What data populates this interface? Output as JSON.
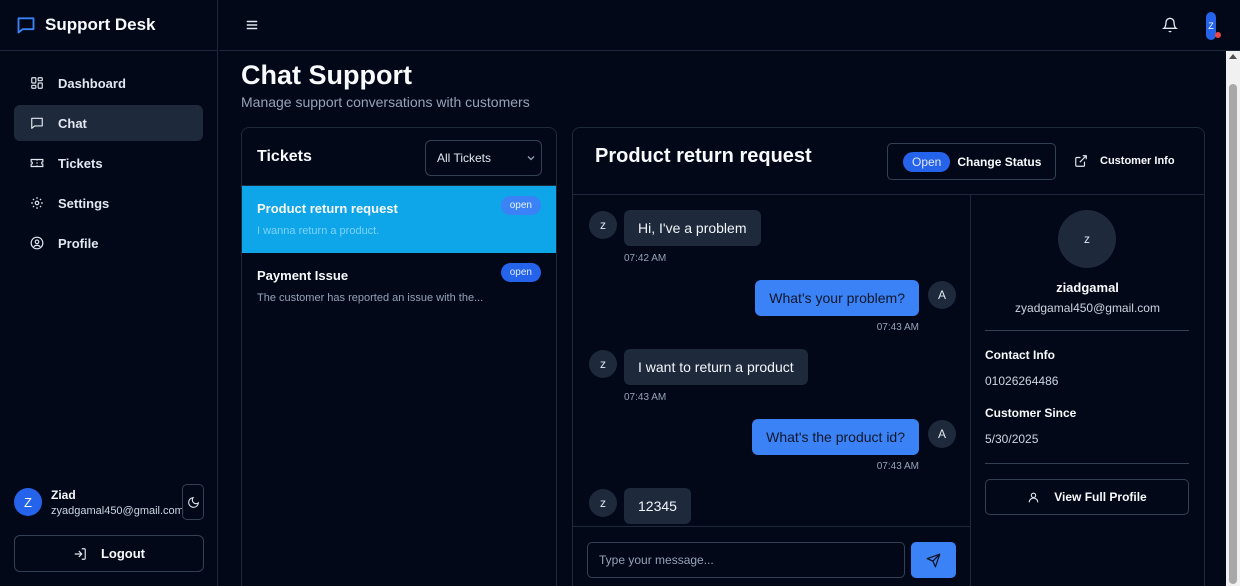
{
  "app": {
    "title": "Support Desk"
  },
  "sidebar": {
    "items": [
      {
        "label": "Dashboard",
        "icon": "dashboard-icon"
      },
      {
        "label": "Chat",
        "icon": "chat-icon",
        "active": true
      },
      {
        "label": "Tickets",
        "icon": "ticket-icon"
      },
      {
        "label": "Settings",
        "icon": "gear-icon"
      },
      {
        "label": "Profile",
        "icon": "user-circle-icon"
      }
    ],
    "user": {
      "initial": "Z",
      "name": "Ziad",
      "email": "zyadgamal450@gmail.com"
    },
    "logout_label": "Logout"
  },
  "topbar": {
    "avatar_initial": "Z"
  },
  "page": {
    "title": "Chat Support",
    "subtitle": "Manage support conversations with customers"
  },
  "tickets": {
    "title": "Tickets",
    "filter": "All Tickets",
    "items": [
      {
        "title": "Product return request",
        "preview": "I wanna return a product.",
        "status": "open",
        "selected": true
      },
      {
        "title": "Payment Issue",
        "preview": "The customer has reported an issue with the...",
        "status": "open",
        "selected": false
      }
    ]
  },
  "chat": {
    "title": "Product return request",
    "status_pill": "Open",
    "change_status_label": "Change Status",
    "customer_info_label": "Customer Info",
    "messages": [
      {
        "from": "customer",
        "avatar": "z",
        "text": "Hi, I've a problem",
        "time": "07:42 AM"
      },
      {
        "from": "agent",
        "avatar": "A",
        "text": "What's your problem?",
        "time": "07:43 AM"
      },
      {
        "from": "customer",
        "avatar": "z",
        "text": "I want to return a product",
        "time": "07:43 AM"
      },
      {
        "from": "agent",
        "avatar": "A",
        "text": "What's the product id?",
        "time": "07:43 AM"
      },
      {
        "from": "customer",
        "avatar": "z",
        "text": "12345",
        "time": ""
      }
    ],
    "input_placeholder": "Type your message..."
  },
  "customer": {
    "initial": "z",
    "name": "ziadgamal",
    "email": "zyadgamal450@gmail.com",
    "contact_label": "Contact Info",
    "contact_value": "01026264486",
    "since_label": "Customer Since",
    "since_value": "5/30/2025",
    "profile_button": "View Full Profile"
  },
  "colors": {
    "accent": "#3b82f6",
    "selected_ticket": "#0ea5e9",
    "background": "#020817",
    "border": "#1e293b"
  }
}
